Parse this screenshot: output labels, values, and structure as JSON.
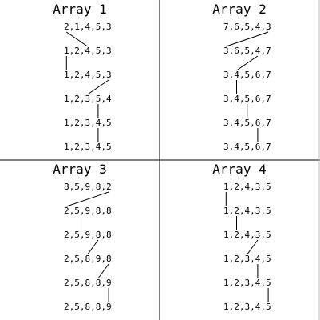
{
  "panels": [
    {
      "title": "Array 1",
      "rows": [
        "2,1,4,5,3",
        "1,2,4,5,3",
        "1,2,4,5,3",
        "1,2,3,5,4",
        "1,2,3,4,5",
        "1,2,3,4,5"
      ],
      "swaps": [
        [
          1,
          3
        ],
        [
          1,
          1
        ],
        [
          5,
          3
        ],
        [
          4,
          4
        ],
        [
          4,
          4
        ]
      ]
    },
    {
      "title": "Array 2",
      "rows": [
        "7,6,5,4,3",
        "3,6,5,4,7",
        "3,4,5,6,7",
        "3,4,5,6,7",
        "3,4,5,6,7",
        "3,4,5,6,7"
      ],
      "swaps": [
        [
          5,
          1
        ],
        [
          4,
          2
        ],
        [
          2,
          2
        ],
        [
          3,
          3
        ],
        [
          4,
          4
        ]
      ]
    },
    {
      "title": "Array 3",
      "rows": [
        "8,5,9,8,2",
        "2,5,9,8,8",
        "2,5,9,8,8",
        "2,5,8,9,8",
        "2,5,8,8,9",
        "2,5,8,8,9"
      ],
      "swaps": [
        [
          5,
          1
        ],
        [
          2,
          2
        ],
        [
          4,
          3
        ],
        [
          5,
          4
        ],
        [
          5,
          5
        ]
      ]
    },
    {
      "title": "Array 4",
      "rows": [
        "1,2,4,3,5",
        "1,2,4,3,5",
        "1,2,4,3,5",
        "1,2,3,4,5",
        "1,2,3,4,5",
        "1,2,3,4,5"
      ],
      "swaps": [
        [
          1,
          1
        ],
        [
          2,
          2
        ],
        [
          4,
          3
        ],
        [
          4,
          4
        ],
        [
          5,
          5
        ]
      ]
    }
  ],
  "colors": {
    "line": "#000000",
    "border": "#000000",
    "background": "#ffffff"
  }
}
